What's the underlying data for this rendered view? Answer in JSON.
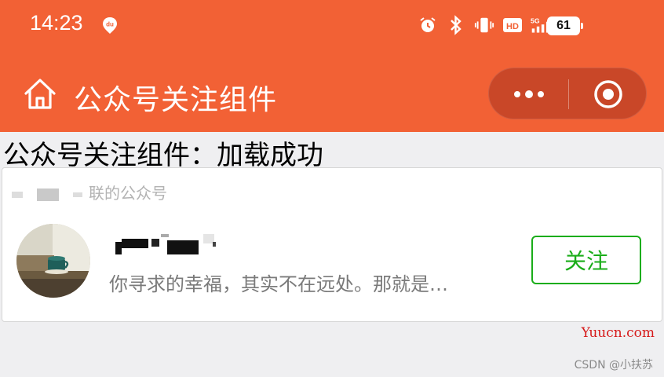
{
  "status_bar": {
    "time": "14:23",
    "battery": "61",
    "icons": [
      "baidu-location-icon",
      "alarm-icon",
      "bluetooth-icon",
      "vibrate-icon",
      "hd-icon",
      "signal-5g-icon",
      "wifi-icon",
      "battery-icon"
    ]
  },
  "nav": {
    "title": "公众号关注组件",
    "icons": [
      "home-icon",
      "more-icon",
      "close-miniprogram-icon"
    ]
  },
  "main": {
    "load_status": "公众号关注组件：加载成功"
  },
  "card": {
    "header_visible": "联的公众号",
    "description": "你寻求的幸福，其实不在远处。那就是…",
    "follow_label": "关注"
  },
  "watermarks": {
    "site": "Yuucn.com",
    "csdn": "CSDN @小扶苏"
  },
  "colors": {
    "brand_orange": "#f26135",
    "capsule": "#c94728",
    "follow_green": "#1aad19",
    "watermark_red": "#d61a1a"
  }
}
